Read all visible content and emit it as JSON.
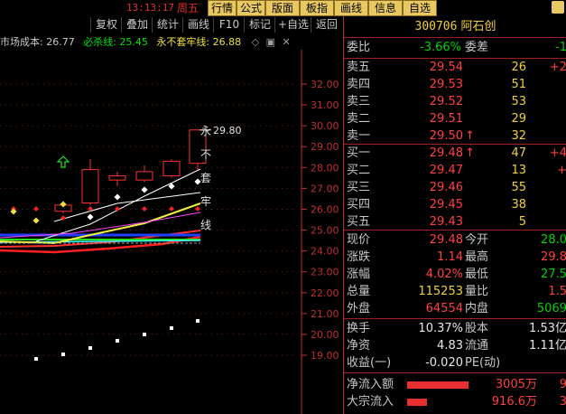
{
  "topbar": {
    "time": "13:13:17",
    "weekday": "周五",
    "buttons": [
      "行情",
      "公式",
      "版面",
      "板指",
      "画线",
      "信息",
      "自选"
    ]
  },
  "toolbar": {
    "buttons": [
      "复权",
      "叠加",
      "统计",
      "画线",
      "F10",
      "标记",
      "+自选",
      "返回"
    ]
  },
  "chart": {
    "info": {
      "market_cost_label": "市场成本: 26.77",
      "must_kill_label": "必杀线: 25.45",
      "never_trap_label": "永不套牢线: 26.88"
    },
    "price_axis": [
      "32.00",
      "31.00",
      "30.00",
      "29.00",
      "28.00",
      "27.00",
      "26.00",
      "25.00",
      "24.00",
      "23.00",
      "22.00",
      "21.00",
      "20.00",
      "19.00"
    ],
    "high_marker": "29.80",
    "annotation_chars": [
      "永",
      "不",
      "套",
      "牢",
      "线"
    ],
    "colors": {
      "up": "#ff3030",
      "down": "#00ffff",
      "bg": "#000000"
    }
  },
  "quote": {
    "code": "300706",
    "name": "阿石创",
    "weibi": {
      "label": "委比",
      "value": "-3.66%"
    },
    "weicha": {
      "label": "委差",
      "value": "-1"
    },
    "asks": [
      {
        "label": "卖五",
        "price": "29.54",
        "vol": "26",
        "extra": "+2"
      },
      {
        "label": "卖四",
        "price": "29.53",
        "vol": "51",
        "extra": ""
      },
      {
        "label": "卖三",
        "price": "29.52",
        "vol": "53",
        "extra": ""
      },
      {
        "label": "卖二",
        "price": "29.51",
        "vol": "29",
        "extra": ""
      },
      {
        "label": "卖一",
        "price": "29.50",
        "vol": "32",
        "extra": ""
      }
    ],
    "bids": [
      {
        "label": "买一",
        "price": "29.48",
        "vol": "47",
        "extra": "+4"
      },
      {
        "label": "买二",
        "price": "29.47",
        "vol": "13",
        "extra": "+"
      },
      {
        "label": "买三",
        "price": "29.46",
        "vol": "55",
        "extra": ""
      },
      {
        "label": "买四",
        "price": "29.45",
        "vol": "38",
        "extra": ""
      },
      {
        "label": "买五",
        "price": "29.43",
        "vol": "5",
        "extra": ""
      }
    ],
    "stats": [
      {
        "l1": "现价",
        "v1": "29.48",
        "l2": "今开",
        "v2": "28.0"
      },
      {
        "l1": "涨跌",
        "v1": "1.14",
        "l2": "最高",
        "v2": "29.8"
      },
      {
        "l1": "涨幅",
        "v1": "4.02%",
        "l2": "最低",
        "v2": "27.5"
      },
      {
        "l1": "总量",
        "v1": "115253",
        "l2": "量比",
        "v2": "1.5"
      },
      {
        "l1": "外盘",
        "v1": "64554",
        "l2": "内盘",
        "v2": "5069"
      }
    ],
    "stats2": [
      {
        "l1": "换手",
        "v1": "10.37%",
        "l2": "股本",
        "v2": "1.53亿"
      },
      {
        "l1": "净资",
        "v1": "4.83",
        "l2": "流通",
        "v2": "1.11亿"
      },
      {
        "l1": "收益(一)",
        "v1": "-0.020",
        "l2": "PE(动)",
        "v2": ""
      }
    ],
    "flows": [
      {
        "label": "净流入额",
        "value": "3005万",
        "extra": "9",
        "fill": 0.68
      },
      {
        "label": "大宗流入",
        "value": "916.6万",
        "extra": "3",
        "fill": 0.22
      }
    ]
  }
}
